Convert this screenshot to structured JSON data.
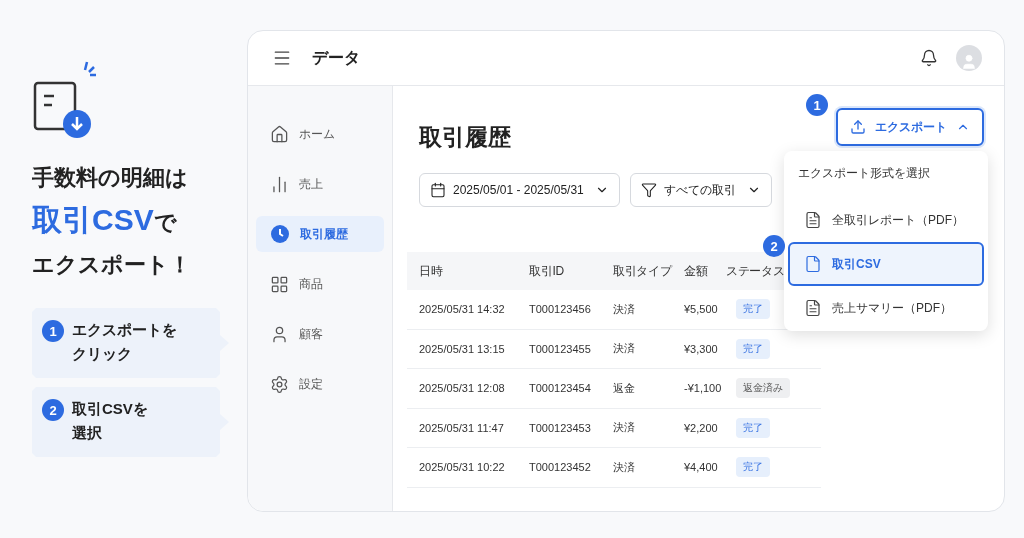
{
  "promo": {
    "headline_top": "手数料の明細は",
    "headline_highlight": "取引CSV",
    "headline_after": "で",
    "headline_bottom": "エクスポート！",
    "steps": [
      {
        "number": "1",
        "lines": [
          "エクスポートを",
          "クリック"
        ]
      },
      {
        "number": "2",
        "lines": [
          "取引CSVを",
          "選択"
        ]
      }
    ]
  },
  "app": {
    "title": "データ",
    "sidebar": {
      "items": [
        {
          "label": "ホーム",
          "selected": false
        },
        {
          "label": "売上",
          "selected": false
        },
        {
          "label": "取引履歴",
          "selected": true
        },
        {
          "label": "商品",
          "selected": false
        },
        {
          "label": "顧客",
          "selected": false
        },
        {
          "label": "設定",
          "selected": false
        }
      ]
    },
    "page_title": "取引履歴",
    "export_button": {
      "label": "エクスポート",
      "expanded": true,
      "step": "1"
    },
    "filters": [
      {
        "kind": "date",
        "value": "2025/05/01 - 2025/05/31"
      },
      {
        "kind": "filter",
        "value": "すべての取引"
      }
    ],
    "table": {
      "columns": [
        "日時",
        "取引ID",
        "取引タイプ",
        "金額",
        "ステータス"
      ],
      "rows": [
        {
          "cells": [
            "2025/05/31 14:32",
            "T000123456",
            "決済",
            "¥5,500"
          ],
          "status": {
            "label": "完了",
            "kind": "done"
          }
        },
        {
          "cells": [
            "2025/05/31 13:15",
            "T000123455",
            "決済",
            "¥3,300"
          ],
          "status": {
            "label": "完了",
            "kind": "done"
          }
        },
        {
          "cells": [
            "2025/05/31 12:08",
            "T000123454",
            "返金",
            "-¥1,100"
          ],
          "status": {
            "label": "返金済み",
            "kind": "refunded"
          }
        },
        {
          "cells": [
            "2025/05/31 11:47",
            "T000123453",
            "決済",
            "¥2,200"
          ],
          "status": {
            "label": "完了",
            "kind": "done"
          }
        },
        {
          "cells": [
            "2025/05/31 10:22",
            "T000123452",
            "決済",
            "¥4,400"
          ],
          "status": {
            "label": "完了",
            "kind": "done"
          }
        }
      ]
    },
    "export_menu": {
      "title": "エクスポート形式を選択",
      "items": [
        {
          "label": "全取引レポート（PDF）",
          "selected": false
        },
        {
          "label": "取引CSV",
          "selected": true,
          "step": "2"
        },
        {
          "label": "売上サマリー（PDF）",
          "selected": false
        }
      ]
    }
  }
}
